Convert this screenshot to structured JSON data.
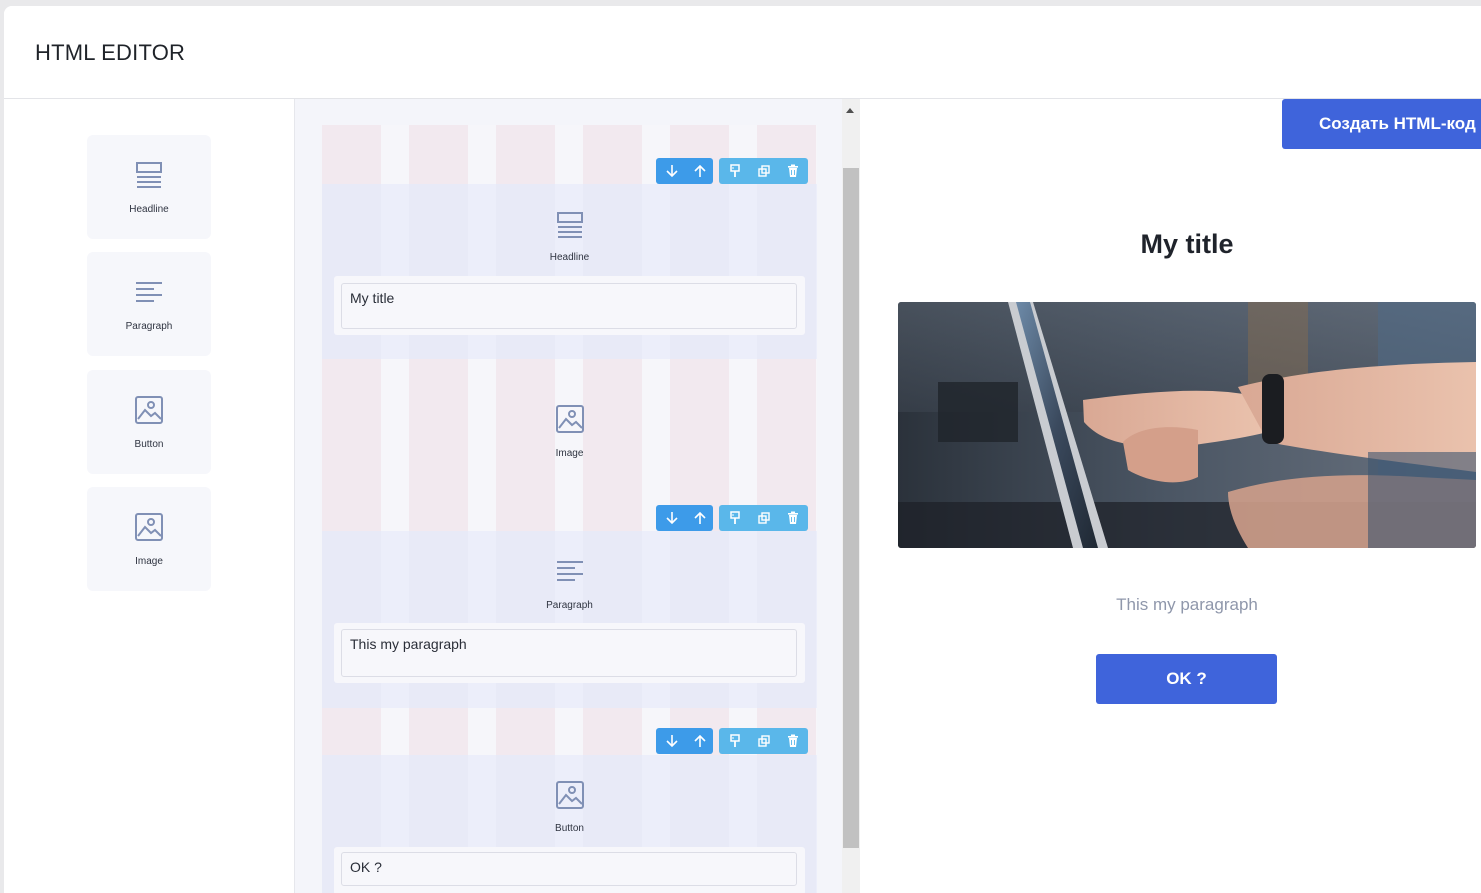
{
  "app": {
    "title": "HTML EDITOR"
  },
  "palette": {
    "items": [
      {
        "label": "Headline",
        "icon": "headline-icon"
      },
      {
        "label": "Paragraph",
        "icon": "paragraph-icon"
      },
      {
        "label": "Button",
        "icon": "image-icon"
      },
      {
        "label": "Image",
        "icon": "image-icon"
      }
    ]
  },
  "canvas": {
    "blocks": [
      {
        "label": "Headline",
        "icon": "headline-icon",
        "field_value": "My title"
      },
      {
        "label": "Image",
        "icon": "image-icon"
      },
      {
        "label": "Paragraph",
        "icon": "paragraph-icon",
        "field_value": "This my paragraph"
      },
      {
        "label": "Button",
        "icon": "image-icon",
        "field_value": "OK ?"
      }
    ],
    "toolbar_icons": [
      "move-down-icon",
      "move-up-icon",
      "style-icon",
      "duplicate-icon",
      "delete-icon"
    ]
  },
  "preview": {
    "generate_button": "Создать HTML-код",
    "title": "My title",
    "paragraph": "This my paragraph",
    "button": "OK ?"
  },
  "colors": {
    "accent": "#3f64db",
    "toolbar_dark": "#3d9be9",
    "toolbar_light": "#5ab7ea",
    "icon": "#8090b5"
  }
}
